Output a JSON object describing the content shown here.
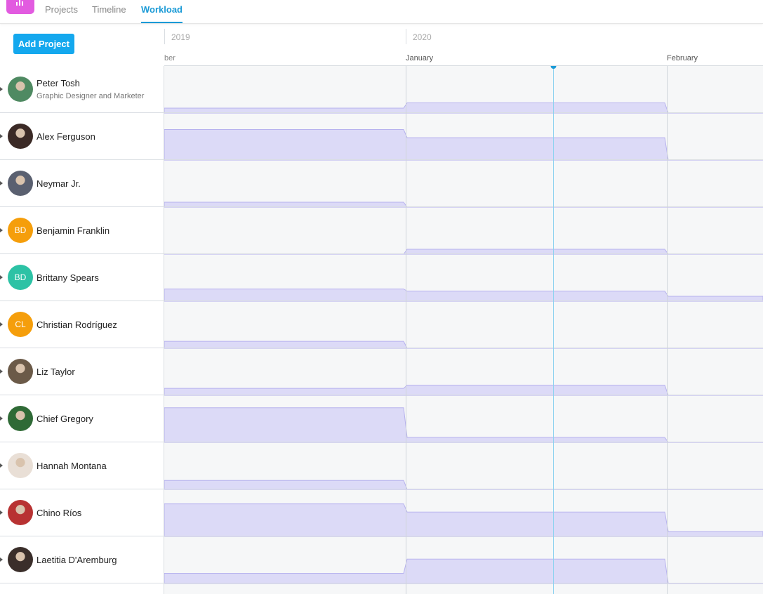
{
  "nav": {
    "tabs": [
      {
        "label": "Projects",
        "active": false
      },
      {
        "label": "Timeline",
        "active": false
      },
      {
        "label": "Workload",
        "active": true
      }
    ]
  },
  "toolbar": {
    "add_project_label": "Add Project"
  },
  "timeline": {
    "years": [
      "2019",
      "2020"
    ],
    "months": [
      "ber",
      "January",
      "February"
    ],
    "today_marker_color": "#1a9ad6"
  },
  "colors": {
    "brand": "#e25be0",
    "accent": "#14a8ee",
    "workload_fill": "#dcdaf7",
    "workload_stroke": "#b6b1ee",
    "avatar_orange": "#f59e0b",
    "avatar_teal": "#2cc2a5"
  },
  "people": [
    {
      "name": "Peter Tosh",
      "role": "Graphic Designer and Marketer",
      "avatar": {
        "type": "photo",
        "color": "#4f8a62"
      },
      "workload": [
        0.12,
        0.25,
        0.0
      ]
    },
    {
      "name": "Alex Ferguson",
      "role": "",
      "avatar": {
        "type": "photo",
        "color": "#3b2a26"
      },
      "workload": [
        0.75,
        0.55,
        0.0
      ]
    },
    {
      "name": "Neymar Jr.",
      "role": "",
      "avatar": {
        "type": "photo",
        "color": "#5a6070"
      },
      "workload": [
        0.12,
        0.0,
        0.0
      ]
    },
    {
      "name": "Benjamin Franklin",
      "role": "",
      "avatar": {
        "type": "initials",
        "initials": "BD",
        "color": "#f59e0b"
      },
      "workload": [
        0.0,
        0.12,
        0.0
      ]
    },
    {
      "name": "Brittany Spears",
      "role": "",
      "avatar": {
        "type": "initials",
        "initials": "BD",
        "color": "#2cc2a5"
      },
      "workload": [
        0.3,
        0.25,
        0.12
      ]
    },
    {
      "name": "Christian Rodríguez",
      "role": "",
      "avatar": {
        "type": "initials",
        "initials": "CL",
        "color": "#f59e0b"
      },
      "workload": [
        0.17,
        0.0,
        0.0
      ]
    },
    {
      "name": "Liz Taylor",
      "role": "",
      "avatar": {
        "type": "photo",
        "color": "#6b5a48"
      },
      "workload": [
        0.17,
        0.25,
        0.0
      ]
    },
    {
      "name": "Chief Gregory",
      "role": "",
      "avatar": {
        "type": "photo",
        "color": "#2f6a36"
      },
      "workload": [
        0.85,
        0.12,
        0.0
      ]
    },
    {
      "name": "Hannah Montana",
      "role": "",
      "avatar": {
        "type": "photo",
        "color": "#e9dfd6"
      },
      "workload": [
        0.22,
        0.0,
        0.0
      ]
    },
    {
      "name": "Chino Ríos",
      "role": "",
      "avatar": {
        "type": "photo",
        "color": "#b83232"
      },
      "workload": [
        0.8,
        0.6,
        0.12
      ]
    },
    {
      "name": "Laetitia D'Aremburg",
      "role": "",
      "avatar": {
        "type": "photo",
        "color": "#3a2e2a"
      },
      "workload": [
        0.25,
        0.6,
        0.0
      ]
    }
  ]
}
